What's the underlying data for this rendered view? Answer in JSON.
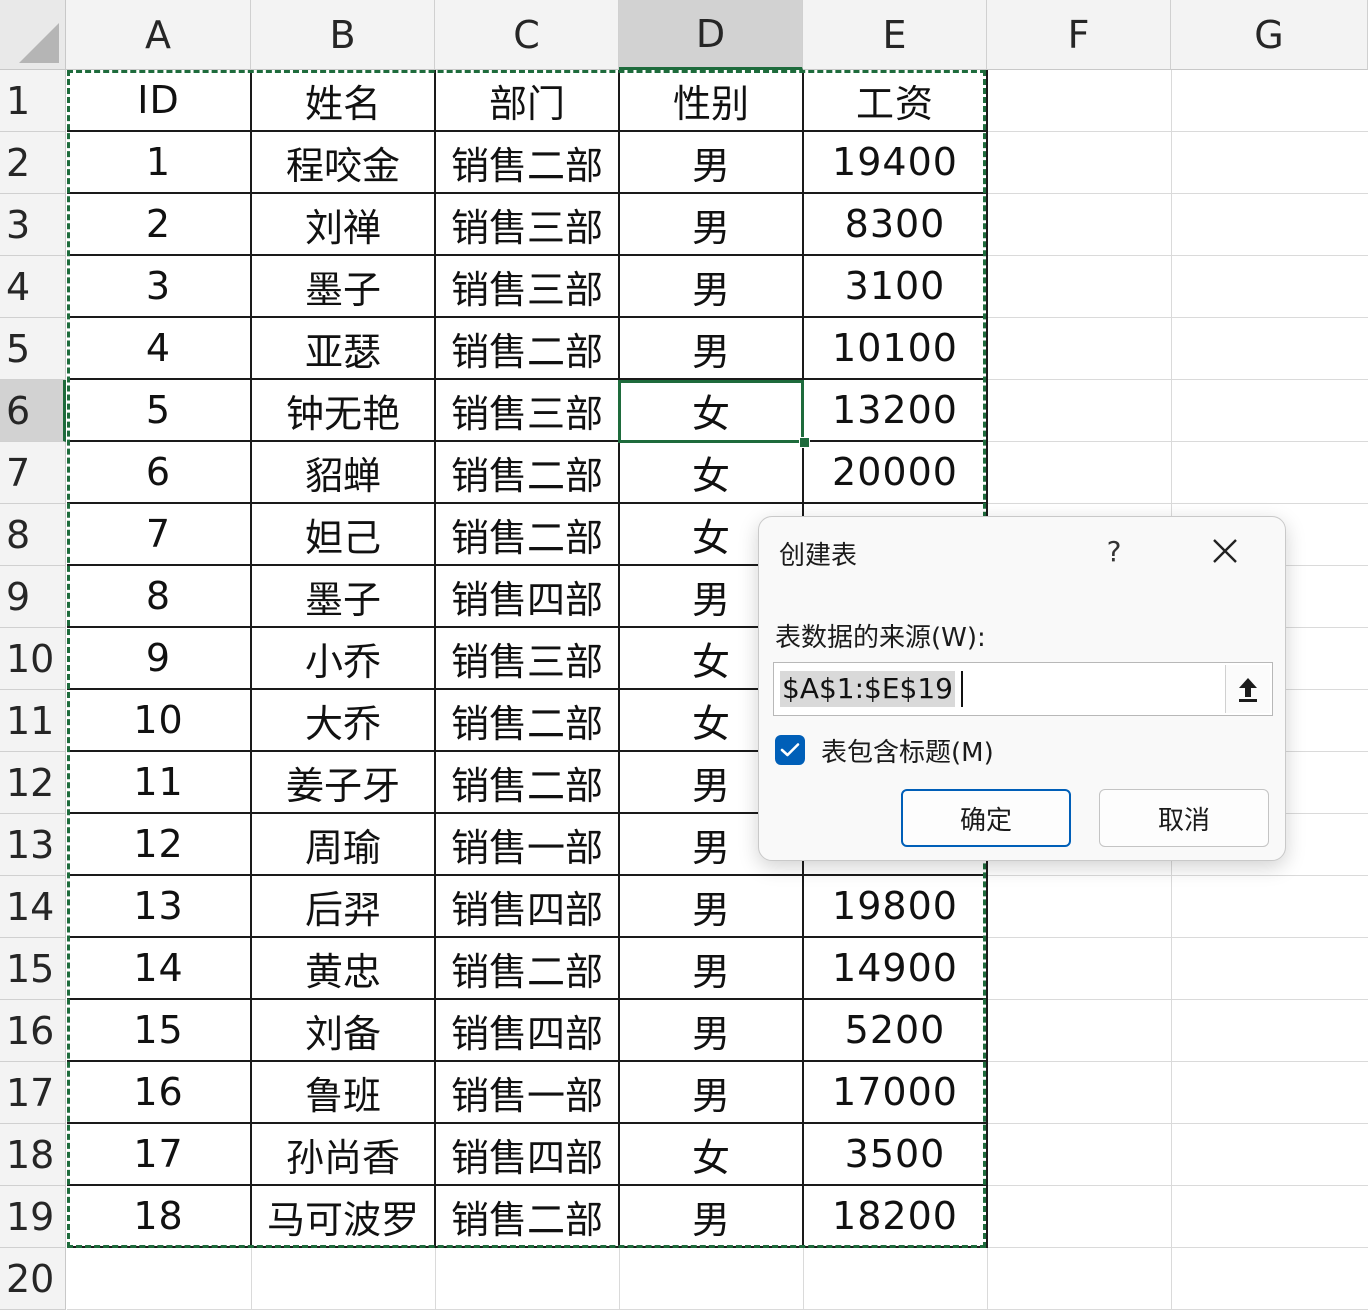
{
  "columns": [
    "A",
    "B",
    "C",
    "D",
    "E",
    "F",
    "G"
  ],
  "rows": [
    "1",
    "2",
    "3",
    "4",
    "5",
    "6",
    "7",
    "8",
    "9",
    "10",
    "11",
    "12",
    "13",
    "14",
    "15",
    "16",
    "17",
    "18",
    "19",
    "20"
  ],
  "table": {
    "headers": [
      "ID",
      "姓名",
      "部门",
      "性别",
      "工资"
    ],
    "records": [
      [
        "1",
        "程咬金",
        "销售二部",
        "男",
        "19400"
      ],
      [
        "2",
        "刘禅",
        "销售三部",
        "男",
        "8300"
      ],
      [
        "3",
        "墨子",
        "销售三部",
        "男",
        "3100"
      ],
      [
        "4",
        "亚瑟",
        "销售二部",
        "男",
        "10100"
      ],
      [
        "5",
        "钟无艳",
        "销售三部",
        "女",
        "13200"
      ],
      [
        "6",
        "貂蝉",
        "销售二部",
        "女",
        "20000"
      ],
      [
        "7",
        "妲己",
        "销售二部",
        "女",
        ""
      ],
      [
        "8",
        "墨子",
        "销售四部",
        "男",
        ""
      ],
      [
        "9",
        "小乔",
        "销售三部",
        "女",
        ""
      ],
      [
        "10",
        "大乔",
        "销售二部",
        "女",
        ""
      ],
      [
        "11",
        "姜子牙",
        "销售二部",
        "男",
        ""
      ],
      [
        "12",
        "周瑜",
        "销售一部",
        "男",
        ""
      ],
      [
        "13",
        "后羿",
        "销售四部",
        "男",
        "19800"
      ],
      [
        "14",
        "黄忠",
        "销售二部",
        "男",
        "14900"
      ],
      [
        "15",
        "刘备",
        "销售四部",
        "男",
        "5200"
      ],
      [
        "16",
        "鲁班",
        "销售一部",
        "男",
        "17000"
      ],
      [
        "17",
        "孙尚香",
        "销售四部",
        "女",
        "3500"
      ],
      [
        "18",
        "马可波罗",
        "销售二部",
        "男",
        "18200"
      ]
    ]
  },
  "selection": {
    "active_cell": "D6",
    "active_column": "D",
    "active_row": "6"
  },
  "dialog": {
    "title": "创建表",
    "help_label": "?",
    "close_icon": "close-icon",
    "source_label": "表数据的来源(W):",
    "range_value": "$A$1:$E$19",
    "collapse_icon": "upload-arrow-icon",
    "has_headers_label": "表包含标题(M)",
    "has_headers_checked": true,
    "ok_label": "确定",
    "cancel_label": "取消"
  },
  "colors": {
    "accent_green": "#1e6b3c",
    "accent_blue": "#005fb8",
    "header_bg": "#f3f3f3",
    "header_active_bg": "#d2d2d2"
  }
}
